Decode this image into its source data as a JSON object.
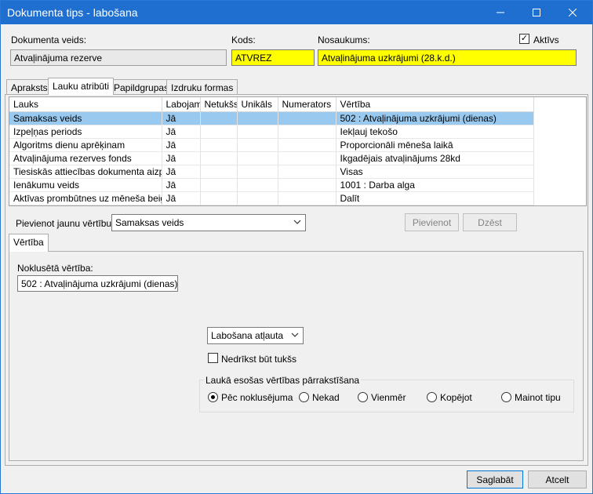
{
  "window": {
    "title": "Dokumenta tips - labošana"
  },
  "header": {
    "doc_type_label": "Dokumenta veids:",
    "doc_type_value": "Atvaļinājuma rezerve",
    "code_label": "Kods:",
    "code_value": "ATVREZ",
    "name_label": "Nosaukums:",
    "name_value": "Atvaļinājuma uzkrājumi (28.k.d.)",
    "active_label": "Aktīvs",
    "active_checked": "✓"
  },
  "tabs": [
    "Apraksts",
    "Lauku atribūti",
    "Papildgrupas",
    "Izdruku formas"
  ],
  "grid": {
    "columns": [
      "Lauks",
      "Labojams",
      "Netukšs",
      "Unikāls",
      "Numerators",
      "Vērtība"
    ],
    "rows": [
      [
        "Samaksas veids",
        "Jā",
        "",
        "",
        "",
        "502 : Atvaļinājuma uzkrājumi (dienas)"
      ],
      [
        "Izpeļņas periods",
        "Jā",
        "",
        "",
        "",
        "Iekļauj tekošo"
      ],
      [
        "Algoritms dienu aprēķinam",
        "Jā",
        "",
        "",
        "",
        "Proporcionāli mēneša laikā"
      ],
      [
        "Atvaļinājuma rezerves fonds",
        "Jā",
        "",
        "",
        "",
        "Ikgadējais atvaļinājums 28kd"
      ],
      [
        "Tiesiskās attiecības dokumenta aizpildē",
        "Jā",
        "",
        "",
        "",
        "Visas"
      ],
      [
        "Ienākumu veids",
        "Jā",
        "",
        "",
        "",
        "1001 : Darba alga"
      ],
      [
        "Aktīvas prombūtnes uz mēneša beigām",
        "Jā",
        "",
        "",
        "",
        "Dalīt"
      ]
    ]
  },
  "add_value": {
    "label": "Pievienot jaunu vērtību:",
    "selected": "Samaksas veids",
    "add_button": "Pievienot",
    "delete_button": "Dzēst"
  },
  "value_tab": {
    "tab_label": "Vērtība",
    "default_label": "Noklusētā vērtība:",
    "default_value": "502 : Atvaļinājuma uzkrājumi (dienas)",
    "edit_mode": "Labošana atļauta",
    "not_empty_label": "Nedrīkst būt tukšs",
    "overwrite_group_label": "Laukā esošas vērtības pārrakstīšana",
    "options": [
      "Pēc noklusējuma",
      "Nekad",
      "Vienmēr",
      "Kopējot",
      "Mainot tipu"
    ]
  },
  "footer": {
    "save": "Saglabāt",
    "cancel": "Atcelt"
  }
}
